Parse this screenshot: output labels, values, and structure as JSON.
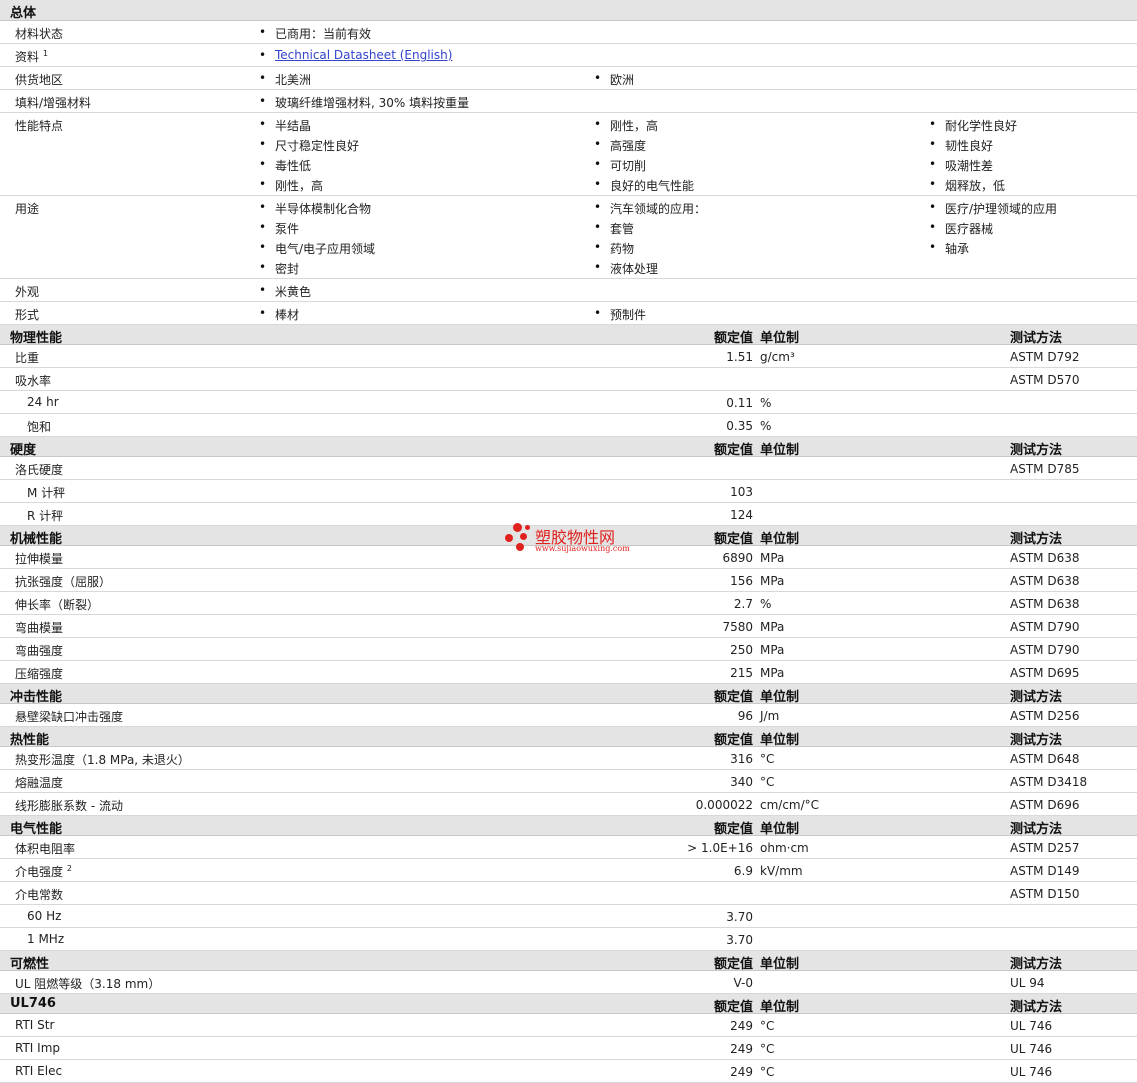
{
  "general": {
    "title": "总体",
    "rows": [
      {
        "label": "材料状态",
        "items": [
          [
            "已商用：当前有效"
          ]
        ]
      },
      {
        "label": "资料",
        "sup": "1",
        "items": [
          [
            "Technical Datasheet (English)"
          ]
        ],
        "link": true
      },
      {
        "label": "供货地区",
        "items": [
          [
            "北美洲"
          ],
          [
            "欧洲"
          ]
        ]
      },
      {
        "label": "填料/增强材料",
        "items": [
          [
            "玻璃纤维增强材料, 30% 填料按重量"
          ]
        ]
      },
      {
        "label": "性能特点",
        "items": [
          [
            "半结晶",
            "尺寸稳定性良好",
            "毒性低",
            "刚性，高"
          ],
          [
            "刚性，高",
            "高强度",
            "可切削",
            "良好的电气性能"
          ],
          [
            "耐化学性良好",
            "韧性良好",
            "吸潮性差",
            "烟释放，低"
          ]
        ]
      },
      {
        "label": "用途",
        "items": [
          [
            "半导体模制化合物",
            "泵件",
            "电气/电子应用领域",
            "密封"
          ],
          [
            "汽车领域的应用：",
            "套管",
            "药物",
            "液体处理"
          ],
          [
            "医疗/护理领域的应用",
            "医疗器械",
            "轴承"
          ]
        ]
      },
      {
        "label": "外观",
        "items": [
          [
            "米黄色"
          ]
        ]
      },
      {
        "label": "形式",
        "items": [
          [
            "棒材"
          ],
          [
            "预制件"
          ]
        ]
      }
    ]
  },
  "headers": {
    "value": "额定值",
    "unit": "单位制",
    "method": "测试方法"
  },
  "sections": [
    {
      "title": "物理性能",
      "rows": [
        {
          "label": "比重",
          "value": "1.51",
          "unit": "g/cm³",
          "method": "ASTM D792"
        },
        {
          "label": "吸水率",
          "value": "",
          "unit": "",
          "method": "ASTM D570"
        },
        {
          "label": "24 hr",
          "sub": true,
          "value": "0.11",
          "unit": "%",
          "method": ""
        },
        {
          "label": "饱和",
          "sub": true,
          "value": "0.35",
          "unit": "%",
          "method": ""
        }
      ]
    },
    {
      "title": "硬度",
      "rows": [
        {
          "label": "洛氏硬度",
          "value": "",
          "unit": "",
          "method": "ASTM D785"
        },
        {
          "label": "M 计秤",
          "sub": true,
          "value": "103",
          "unit": "",
          "method": ""
        },
        {
          "label": "R 计秤",
          "sub": true,
          "value": "124",
          "unit": "",
          "method": ""
        }
      ]
    },
    {
      "title": "机械性能",
      "rows": [
        {
          "label": "拉伸模量",
          "value": "6890",
          "unit": "MPa",
          "method": "ASTM D638"
        },
        {
          "label": "抗张强度（屈服）",
          "value": "156",
          "unit": "MPa",
          "method": "ASTM D638"
        },
        {
          "label": "伸长率（断裂）",
          "value": "2.7",
          "unit": "%",
          "method": "ASTM D638"
        },
        {
          "label": "弯曲模量",
          "value": "7580",
          "unit": "MPa",
          "method": "ASTM D790"
        },
        {
          "label": "弯曲强度",
          "value": "250",
          "unit": "MPa",
          "method": "ASTM D790"
        },
        {
          "label": "压缩强度",
          "value": "215",
          "unit": "MPa",
          "method": "ASTM D695"
        }
      ]
    },
    {
      "title": "冲击性能",
      "rows": [
        {
          "label": "悬壁梁缺口冲击强度",
          "value": "96",
          "unit": "J/m",
          "method": "ASTM D256"
        }
      ]
    },
    {
      "title": "热性能",
      "rows": [
        {
          "label": "热变形温度（1.8 MPa, 未退火）",
          "value": "316",
          "unit": "°C",
          "method": "ASTM D648"
        },
        {
          "label": "熔融温度",
          "value": "340",
          "unit": "°C",
          "method": "ASTM D3418"
        },
        {
          "label": "线形膨胀系数 - 流动",
          "value": "0.000022",
          "unit": "cm/cm/°C",
          "method": "ASTM D696"
        }
      ]
    },
    {
      "title": "电气性能",
      "rows": [
        {
          "label": "体积电阻率",
          "value": "> 1.0E+16",
          "unit": "ohm·cm",
          "method": "ASTM D257"
        },
        {
          "label": "介电强度",
          "sup": "2",
          "value": "6.9",
          "unit": "kV/mm",
          "method": "ASTM D149"
        },
        {
          "label": "介电常数",
          "value": "",
          "unit": "",
          "method": "ASTM D150"
        },
        {
          "label": "60 Hz",
          "sub": true,
          "value": "3.70",
          "unit": "",
          "method": ""
        },
        {
          "label": "1 MHz",
          "sub": true,
          "value": "3.70",
          "unit": "",
          "method": ""
        }
      ]
    },
    {
      "title": "可燃性",
      "rows": [
        {
          "label": "UL 阻燃等级（3.18 mm）",
          "value": "V-0",
          "unit": "",
          "method": "UL 94"
        }
      ]
    },
    {
      "title": "UL746",
      "rows": [
        {
          "label": "RTI Str",
          "value": "249",
          "unit": "°C",
          "method": "UL 746"
        },
        {
          "label": "RTI Imp",
          "value": "249",
          "unit": "°C",
          "method": "UL 746"
        },
        {
          "label": "RTI Elec",
          "value": "249",
          "unit": "°C",
          "method": "UL 746"
        }
      ]
    }
  ],
  "watermark": {
    "text": "塑胶物性网",
    "url": "www.sujiaowuxing.com"
  }
}
